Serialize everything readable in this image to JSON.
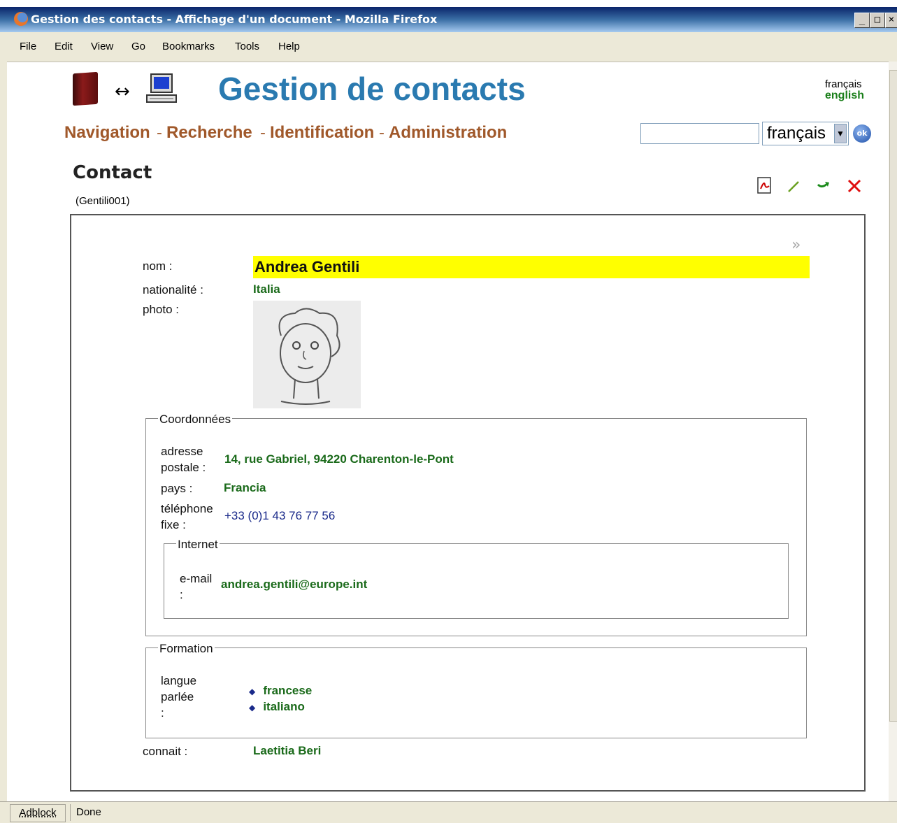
{
  "window": {
    "title": "Gestion des contacts - Affichage d'un document - Mozilla Firefox",
    "controls": [
      "_",
      "□",
      "×"
    ]
  },
  "menu": {
    "file": "File",
    "edit": "Edit",
    "view": "View",
    "go": "Go",
    "bookmarks": "Bookmarks",
    "tools": "Tools",
    "help": "Help"
  },
  "header": {
    "site_title": "Gestion de contacts",
    "lang_links": [
      "français",
      "english"
    ],
    "nav": [
      "Navigation",
      "Recherche",
      "Identification",
      "Administration"
    ],
    "nav_separator": "-",
    "search_value": "",
    "language_select": "français",
    "ok_label": "ok"
  },
  "document": {
    "heading": "Contact",
    "id": "(Gentili001)",
    "toolbar_icons": [
      "pdf-icon",
      "edit-pencil-icon",
      "redo-arrow-icon",
      "delete-x-icon"
    ],
    "fields": {
      "nom_label": "nom :",
      "nom_value": "Andrea Gentili",
      "nationalite_label": "nationalité :",
      "nationalite_value": "Italia",
      "photo_label": "photo :"
    },
    "coordonnees": {
      "legend": "Coordonnées",
      "adresse_label_1": "adresse",
      "adresse_label_2": "postale :",
      "adresse_value": "14, rue Gabriel, 94220 Charenton-le-Pont",
      "pays_label": "pays :",
      "pays_value": "Francia",
      "telephone_label_1": "téléphone",
      "telephone_label_2": "fixe :",
      "telephone_value": "+33 (0)1 43 76 77 56",
      "internet": {
        "legend": "Internet",
        "email_label_1": "e-mail",
        "email_label_2": ":",
        "email_value": "andrea.gentili@europe.int"
      }
    },
    "formation": {
      "legend": "Formation",
      "langue_label_1": "langue",
      "langue_label_2": "parlée",
      "langue_label_3": ":",
      "langues": [
        "francese",
        "italiano"
      ]
    },
    "connait_label": "connait :",
    "connait_value": "Laetitia Beri"
  },
  "statusbar": {
    "adblock": "Adblock",
    "status": "Done"
  },
  "colors": {
    "title_blue": "#2a7ab0",
    "nav_brown": "#a0582a",
    "value_green": "#1a6a1a",
    "highlight_yellow": "#ffff00"
  }
}
